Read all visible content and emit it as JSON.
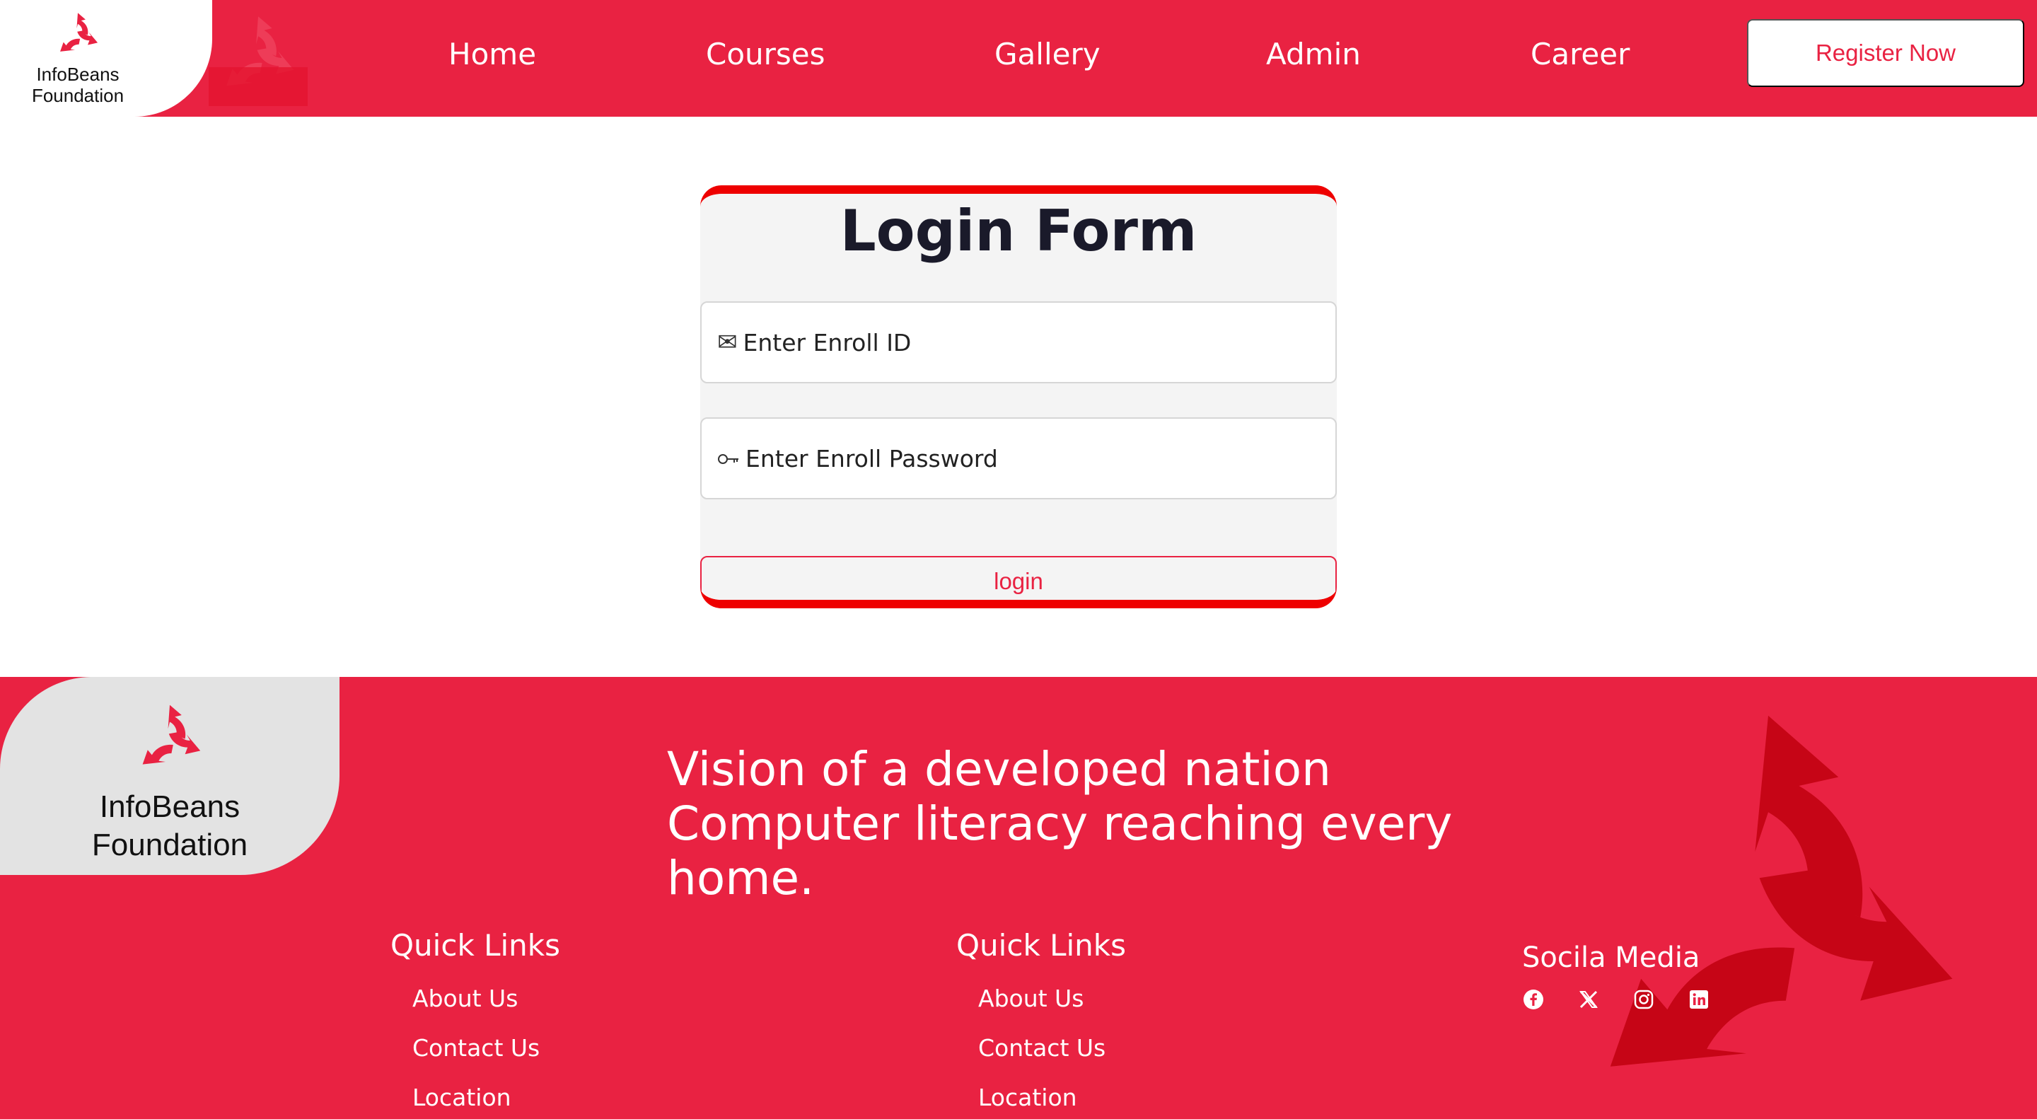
{
  "brand": {
    "name_line1": "InfoBeans",
    "name_line2": "Foundation",
    "primary_color": "#e92242",
    "dark_mark_color": "#c0000f"
  },
  "nav": {
    "items": [
      {
        "label": "Home"
      },
      {
        "label": "Courses"
      },
      {
        "label": "Gallery"
      },
      {
        "label": "Admin"
      },
      {
        "label": "Career"
      }
    ],
    "register_label": "Register Now"
  },
  "login": {
    "title": "Login Form",
    "enroll_id": {
      "icon": "envelope-icon",
      "placeholder": "Enter Enroll ID",
      "value": ""
    },
    "password": {
      "icon": "key-icon",
      "placeholder": "Enter Enroll Password",
      "value": ""
    },
    "submit_label": "login"
  },
  "footer": {
    "vision_line1": "Vision of a developed nation",
    "vision_line2": "Computer literacy reaching every",
    "vision_line3": "home.",
    "quick_links_1": {
      "title": "Quick Links",
      "links": [
        "About Us",
        "Contact Us",
        "Location"
      ]
    },
    "quick_links_2": {
      "title": "Quick Links",
      "links": [
        "About Us",
        "Contact Us",
        "Location"
      ]
    },
    "social": {
      "title": "Socila Media",
      "icons": [
        "facebook-icon",
        "x-icon",
        "instagram-icon",
        "linkedin-icon"
      ]
    }
  }
}
